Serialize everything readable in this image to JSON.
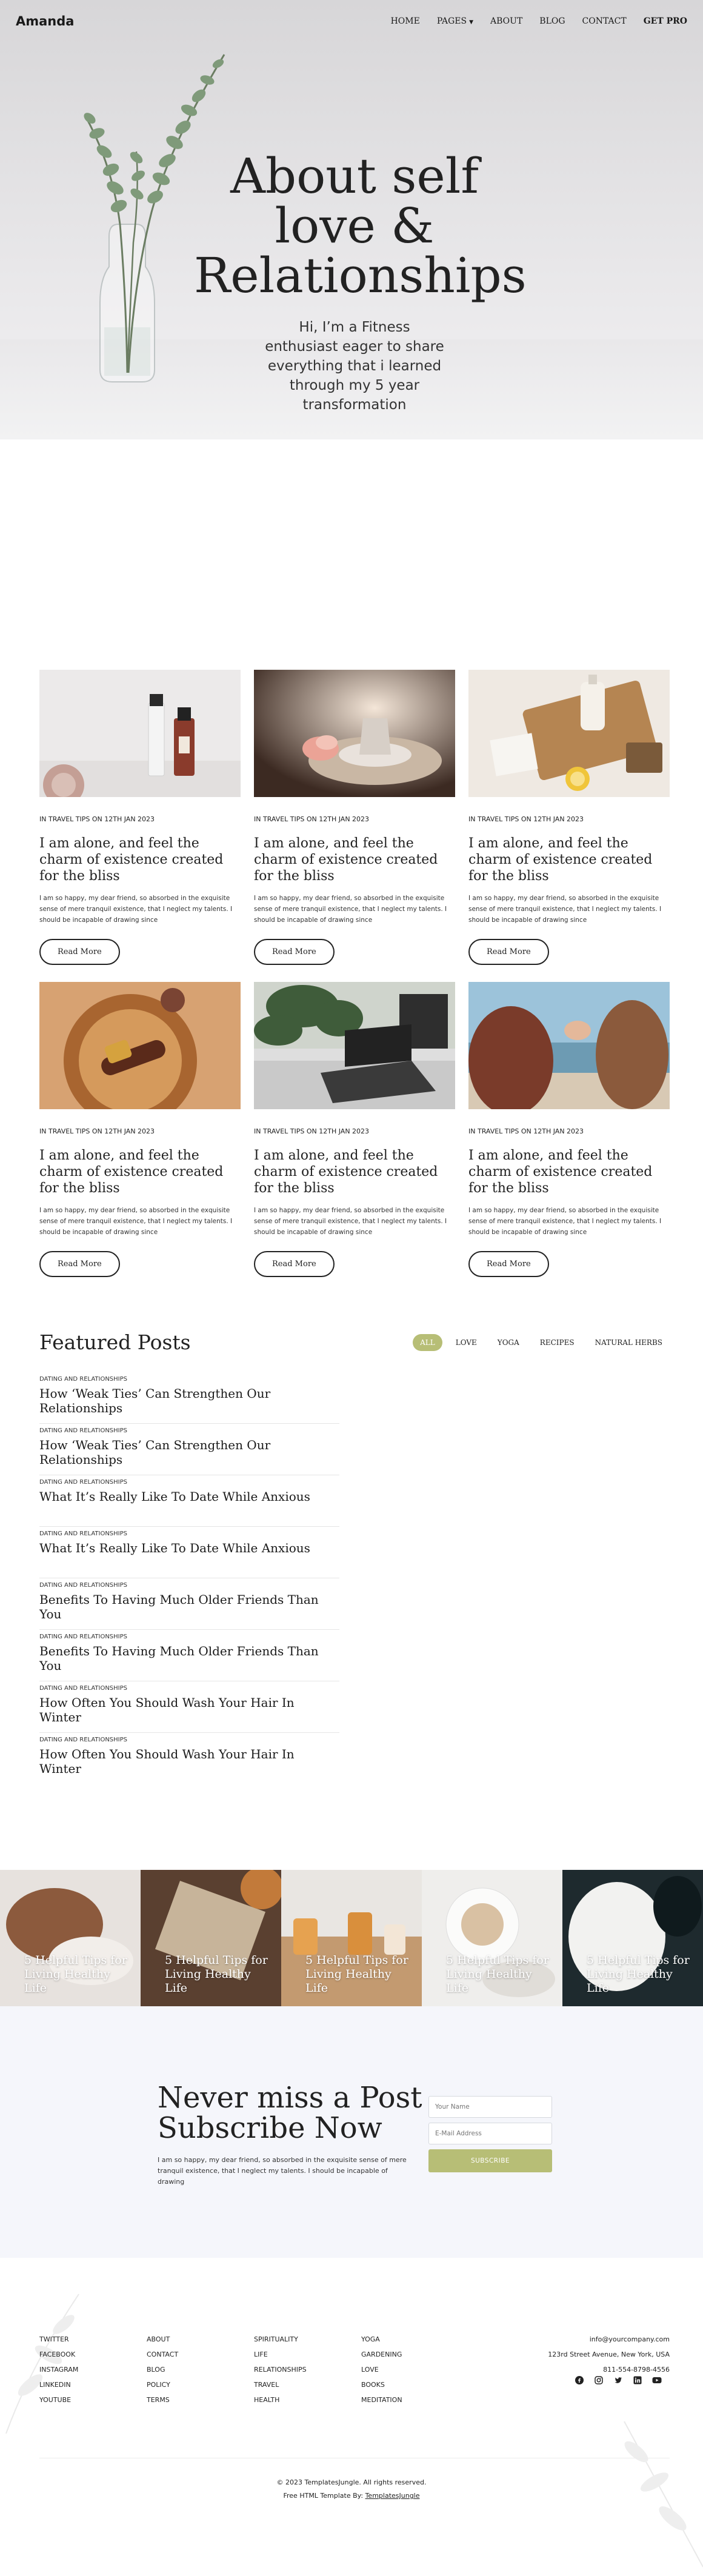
{
  "nav": {
    "logo": "Amanda",
    "items": [
      "HOME",
      "PAGES",
      "ABOUT",
      "BLOG",
      "CONTACT",
      "GET PRO"
    ]
  },
  "hero": {
    "title": "About self love & Relationships",
    "subtitle": "Hi, I’m a Fitness enthusiast eager to share everything that i learned through my 5 year transformation"
  },
  "cards": [
    {
      "meta": "IN TRAVEL TIPS ON 12TH JAN 2023",
      "title": "I am alone, and feel the charm of existence created for the bliss",
      "excerpt": "I am so happy, my dear friend, so absorbed in the exquisite sense of mere tranquil existence, that I neglect my talents. I should be incapable of drawing since",
      "button": "Read More"
    },
    {
      "meta": "IN TRAVEL TIPS ON 12TH JAN 2023",
      "title": "I am alone, and feel the charm of existence created for the bliss",
      "excerpt": "I am so happy, my dear friend, so absorbed in the exquisite sense of mere tranquil existence, that I neglect my talents. I should be incapable of drawing since",
      "button": "Read More"
    },
    {
      "meta": "IN TRAVEL TIPS ON 12TH JAN 2023",
      "title": "I am alone, and feel the charm of existence created for the bliss",
      "excerpt": "I am so happy, my dear friend, so absorbed in the exquisite sense of mere tranquil existence, that I neglect my talents. I should be incapable of drawing since",
      "button": "Read More"
    },
    {
      "meta": "IN TRAVEL TIPS ON 12TH JAN 2023",
      "title": "I am alone, and feel the charm of existence created for the bliss",
      "excerpt": "I am so happy, my dear friend, so absorbed in the exquisite sense of mere tranquil existence, that I neglect my talents. I should be incapable of drawing since",
      "button": "Read More"
    },
    {
      "meta": "IN TRAVEL TIPS ON 12TH JAN 2023",
      "title": "I am alone, and feel the charm of existence created for the bliss",
      "excerpt": "I am so happy, my dear friend, so absorbed in the exquisite sense of mere tranquil existence, that I neglect my talents. I should be incapable of drawing since",
      "button": "Read More"
    },
    {
      "meta": "IN TRAVEL TIPS ON 12TH JAN 2023",
      "title": "I am alone, and feel the charm of existence created for the bliss",
      "excerpt": "I am so happy, my dear friend, so absorbed in the exquisite sense of mere tranquil existence, that I neglect my talents. I should be incapable of drawing since",
      "button": "Read More"
    }
  ],
  "featured": {
    "title": "Featured Posts",
    "filters": [
      "ALL",
      "LOVE",
      "YOGA",
      "RECIPES",
      "NATURAL HERBS"
    ],
    "posts": [
      {
        "category": "DATING AND RELATIONSHIPS",
        "title": "How ‘Weak Ties’ Can Strengthen Our Relationships"
      },
      {
        "category": "DATING AND RELATIONSHIPS",
        "title": "How ‘Weak Ties’ Can Strengthen Our Relationships"
      },
      {
        "category": "DATING AND RELATIONSHIPS",
        "title": "What It’s Really Like To Date While Anxious"
      },
      {
        "category": "DATING AND RELATIONSHIPS",
        "title": "What It’s Really Like To Date While Anxious"
      },
      {
        "category": "DATING AND RELATIONSHIPS",
        "title": "Benefits To Having Much Older Friends Than You"
      },
      {
        "category": "DATING AND RELATIONSHIPS",
        "title": "Benefits To Having Much Older Friends Than You"
      },
      {
        "category": "DATING AND RELATIONSHIPS",
        "title": "How Often You Should Wash Your Hair In Winter"
      },
      {
        "category": "DATING AND RELATIONSHIPS",
        "title": "How Often You Should Wash Your Hair In Winter"
      }
    ]
  },
  "strip": [
    "5 Helpful Tips for Living Healthy Life",
    "5 Helpful Tips for Living Healthy Life",
    "5 Helpful Tips for Living Healthy Life",
    "5 Helpful Tips for Living Healthy Life",
    "5 Helpful Tips for Living Healthy Life"
  ],
  "subscribe": {
    "title": "Never miss a Post Subscribe Now",
    "text": "I am so happy, my dear friend, so absorbed in the exquisite sense of mere tranquil existence, that I neglect my talents. I should be incapable of drawing",
    "name_placeholder": "Your Name",
    "email_placeholder": "E-Mail Address",
    "button": "SUBSCRIBE"
  },
  "footer": {
    "col1": [
      "TWITTER",
      "FACEBOOK",
      "INSTAGRAM",
      "LINKEDIN",
      "YOUTUBE"
    ],
    "col2": [
      "ABOUT",
      "CONTACT",
      "BLOG",
      "POLICY",
      "TERMS"
    ],
    "col3": [
      "SPIRITUALITY",
      "LIFE",
      "RELATIONSHIPS",
      "TRAVEL",
      "HEALTH"
    ],
    "col4": [
      "YOGA",
      "GARDENING",
      "LOVE",
      "BOOKS",
      "MEDITATION"
    ],
    "email": "info@yourcompany.com",
    "address": "123rd Street Avenue, New York, USA",
    "phone": "811-554-8798-4556",
    "socials": [
      "facebook-icon",
      "instagram-icon",
      "twitter-icon",
      "linkedin-icon",
      "youtube-icon"
    ],
    "copyright": "© 2023 TemplatesJungle. All rights reserved.",
    "credit_prefix": "Free HTML Template By: ",
    "credit_link": "TemplatesJungle"
  },
  "colors": {
    "accent": "#b7be76",
    "subscribe_bg": "#f5f6fb",
    "text": "#222222"
  }
}
